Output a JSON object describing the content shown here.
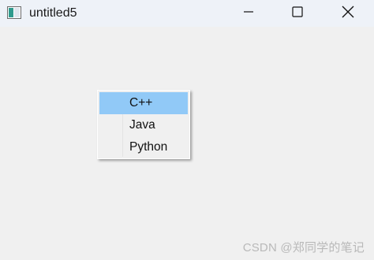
{
  "window": {
    "title": "untitled5",
    "controls": {
      "minimize_icon": "minimize-icon",
      "maximize_icon": "maximize-icon",
      "close_icon": "close-icon"
    }
  },
  "context_menu": {
    "items": [
      {
        "label": "C++",
        "selected": true
      },
      {
        "label": "Java",
        "selected": false
      },
      {
        "label": "Python",
        "selected": false
      }
    ]
  },
  "watermark": "CSDN @郑同学的笔记",
  "colors": {
    "titlebar_bg": "#eef2f8",
    "window_bg": "#f0f0f0",
    "selection_bg": "#91c9f7"
  }
}
